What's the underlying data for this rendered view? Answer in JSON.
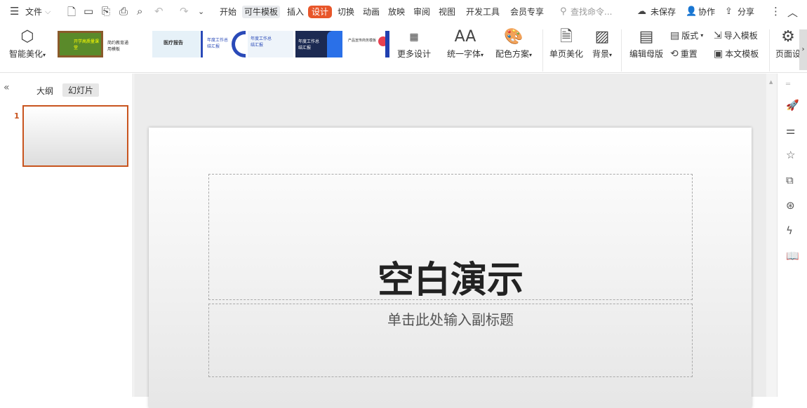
{
  "menu": {
    "file": "文件",
    "tabs": [
      "开始",
      "可牛模板",
      "插入",
      "设计",
      "切换",
      "动画",
      "放映",
      "审阅",
      "视图",
      "开发工具",
      "会员专享"
    ],
    "search_placeholder": "查找命令...",
    "unsaved": "未保存",
    "collab": "协作",
    "share": "分享"
  },
  "ribbon": {
    "smart_beautify": "智能美化",
    "more_design": "更多设计",
    "unify_font": "统一字体",
    "color_scheme": "配色方案",
    "page_beautify": "单页美化",
    "background": "背景",
    "edit_master": "编辑母版",
    "layout": "版式",
    "reset": "重置",
    "import_template": "导入模板",
    "text_template": "本文模板",
    "page_setup": "页面设"
  },
  "templates": [
    {
      "title": "开学高质量课堂",
      "bg": "#5a8a2a"
    },
    {
      "title": "简约教育通用模板",
      "bg": "#ffffff"
    },
    {
      "title": "医疗报告",
      "bg": "#e6f1f8"
    },
    {
      "title": "年度工作总结汇报",
      "bg": "#ffffff"
    },
    {
      "title": "年度工作总结汇报",
      "bg": "#eef4fa"
    },
    {
      "title": "年度工作总结汇报",
      "bg": "#1c2a52"
    },
    {
      "title": "产品宣传商务模板",
      "bg": "#ffffff"
    }
  ],
  "panel": {
    "outline_tab": "大纲",
    "slides_tab": "幻灯片",
    "slide_number": "1"
  },
  "slide": {
    "title": "空白演示",
    "subtitle": "单击此处输入副标题"
  },
  "colors": {
    "accent": "#e8562a"
  }
}
